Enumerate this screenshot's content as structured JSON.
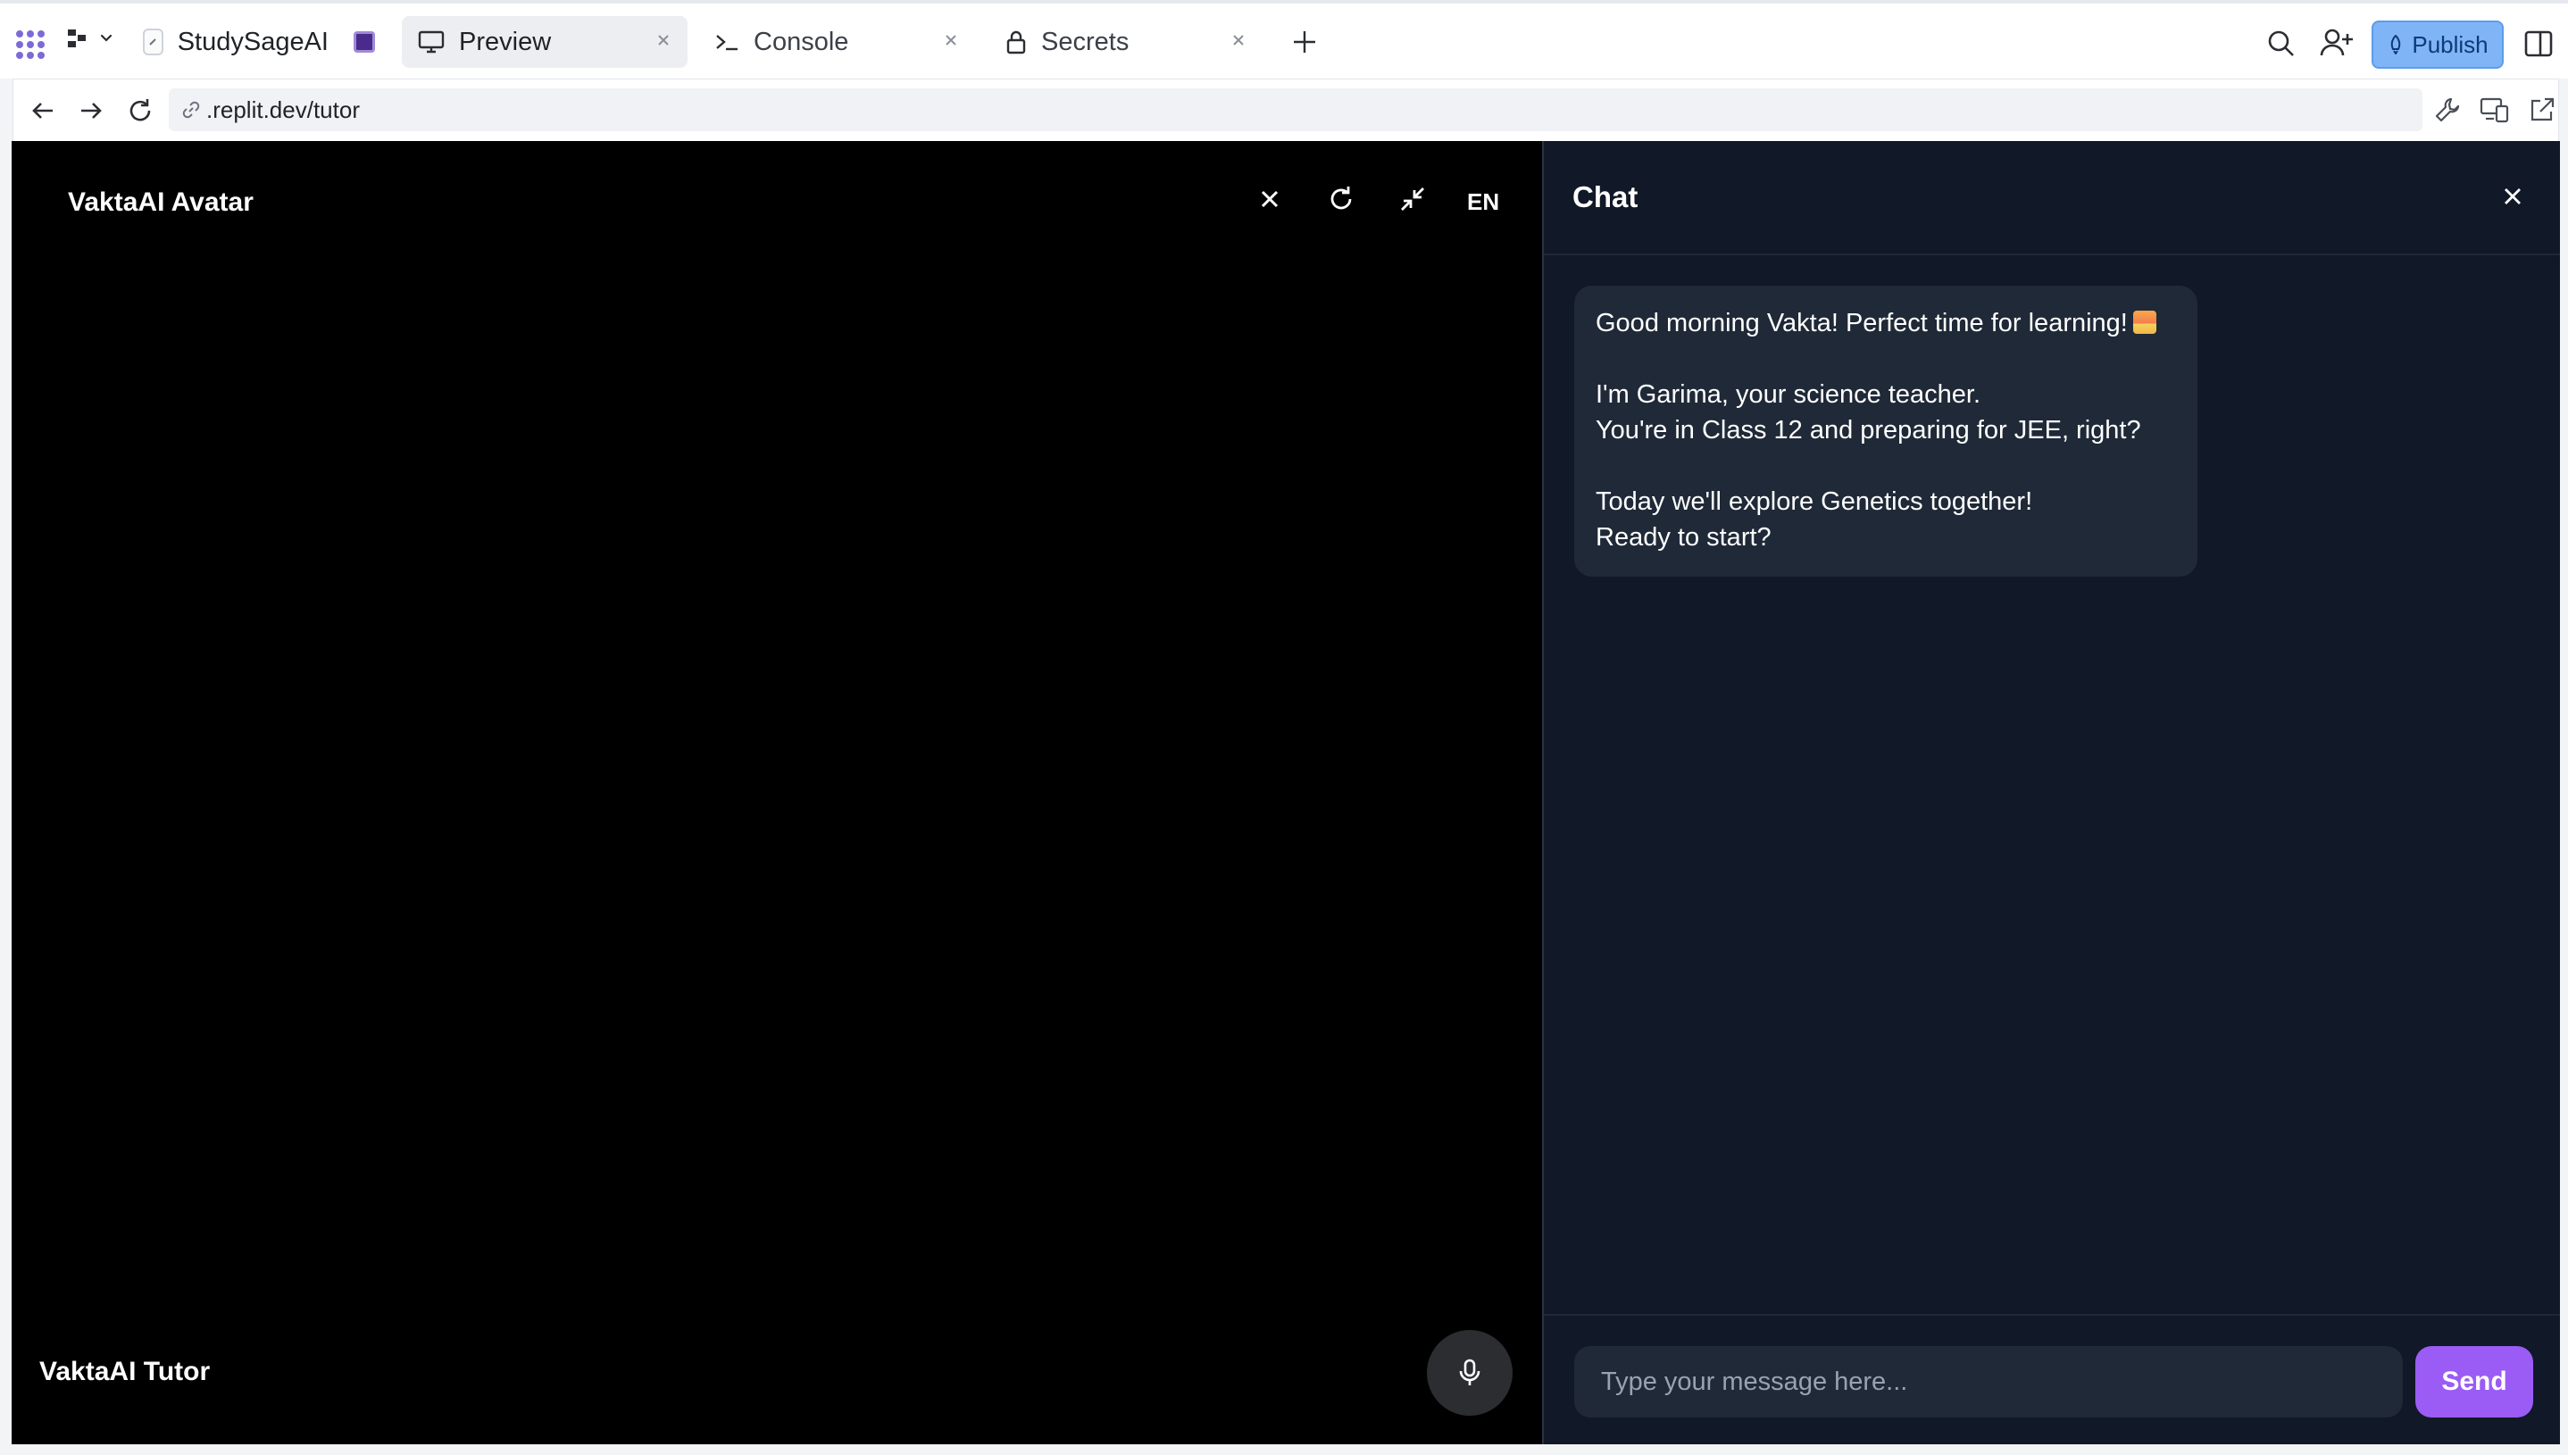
{
  "workspace": {
    "project_name": "StudySageAI",
    "tabs": [
      {
        "label": "Preview",
        "icon": "monitor-icon",
        "active": true
      },
      {
        "label": "Console",
        "icon": "terminal-icon",
        "active": false
      },
      {
        "label": "Secrets",
        "icon": "lock-icon",
        "active": false
      }
    ],
    "publish_label": "Publish",
    "accent_color": "#7fb4f6"
  },
  "browser": {
    "url_prefix": ".replit.dev",
    "url_path": "/tutor"
  },
  "avatar_panel": {
    "title": "VaktaAI Avatar",
    "language": "EN",
    "tutor_label": "VaktaAI Tutor"
  },
  "chat": {
    "title": "Chat",
    "messages": [
      {
        "lines": [
          "Good morning Vakta! Perfect time for learning!",
          "",
          "I'm Garima, your science teacher.",
          "You're in Class 12 and preparing for JEE, right?",
          "",
          "Today we'll explore Genetics together!",
          "Ready to start?"
        ],
        "emoji": "sunrise"
      }
    ],
    "input_placeholder": "Type your message here...",
    "input_value": "",
    "send_label": "Send",
    "send_color": "#9b5cf5"
  }
}
